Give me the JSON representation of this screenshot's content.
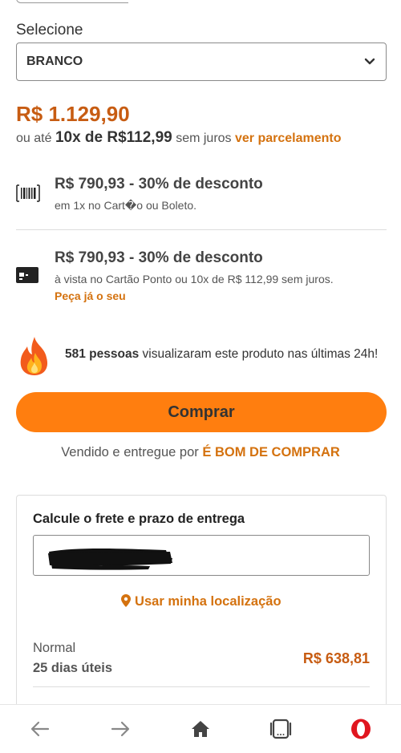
{
  "variant": {
    "label": "Selecione",
    "selected": "BRANCO"
  },
  "pricing": {
    "price": "R$ 1.129,90",
    "installments_prefix": "ou até",
    "installments_value": "10x de R$112,99",
    "installments_suffix": "sem juros",
    "installments_link": "ver parcelamento"
  },
  "offers": [
    {
      "icon": "barcode-icon",
      "title": "R$ 790,93 - 30% de desconto",
      "subtitle": "em 1x no Cart�o ou Boleto."
    },
    {
      "icon": "credit-card-icon",
      "title": "R$ 790,93 - 30% de desconto",
      "subtitle": "à vista no Cartão Ponto ou 10x de R$ 112,99 sem juros.",
      "cta": "Peça já o seu"
    }
  ],
  "social_proof": {
    "icon": "fire-icon",
    "count": "581 pessoas",
    "text": "visualizaram este produto nas últimas 24h!"
  },
  "buy_button": "Comprar",
  "seller": {
    "prefix": "Vendido e entregue por",
    "store": "É BOM DE COMPRAR"
  },
  "freight": {
    "title": "Calcule o frete e prazo de entrega",
    "location_link": "Usar minha localização",
    "options": [
      {
        "name": "Normal",
        "days": "25 dias úteis",
        "price": "R$ 638,81"
      }
    ]
  },
  "navbar": {
    "items": [
      "back-arrow-icon",
      "forward-arrow-icon",
      "home-icon",
      "tabs-icon",
      "opera-icon"
    ]
  },
  "colors": {
    "accent": "#ff7e0f",
    "price": "#c75c12",
    "link": "#d4720f"
  }
}
